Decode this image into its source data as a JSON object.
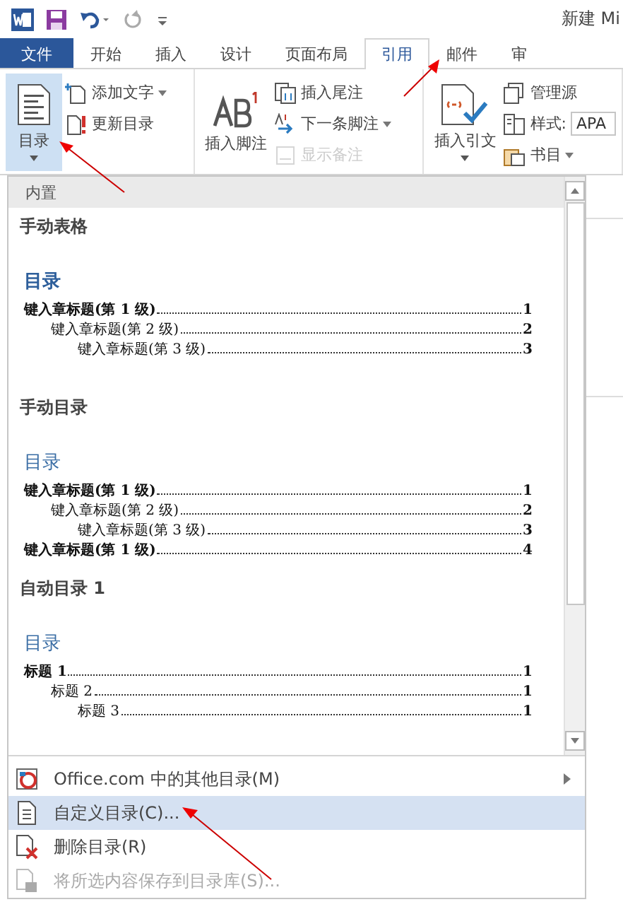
{
  "title_bar": {
    "title": "新建 Mi"
  },
  "tabs": [
    {
      "label": "文件",
      "kind": "file",
      "selected": false
    },
    {
      "label": "开始",
      "kind": "tab",
      "selected": false
    },
    {
      "label": "插入",
      "kind": "tab",
      "selected": false
    },
    {
      "label": "设计",
      "kind": "tab",
      "selected": false
    },
    {
      "label": "页面布局",
      "kind": "tab",
      "selected": false
    },
    {
      "label": "引用",
      "kind": "tab",
      "selected": true
    },
    {
      "label": "邮件",
      "kind": "tab",
      "selected": false
    },
    {
      "label": "审",
      "kind": "tab",
      "selected": false
    }
  ],
  "ribbon": {
    "groups": [
      {
        "large": {
          "label": "目录",
          "pressed": true,
          "dropdown": true
        },
        "small": [
          {
            "label": "添加文字",
            "kind": "button",
            "dropdown": true,
            "disabled": false
          },
          {
            "label": "更新目录",
            "kind": "button",
            "dropdown": false,
            "disabled": false
          }
        ]
      },
      {
        "large": {
          "label": "插入脚注",
          "pressed": false,
          "dropdown": false
        },
        "small": [
          {
            "label": "插入尾注",
            "kind": "button",
            "dropdown": false,
            "disabled": false
          },
          {
            "label": "下一条脚注",
            "kind": "button",
            "dropdown": true,
            "disabled": false
          },
          {
            "label": "显示备注",
            "kind": "button",
            "dropdown": false,
            "disabled": true
          }
        ]
      },
      {
        "large": {
          "label": "插入引文",
          "pressed": false,
          "dropdown": true
        },
        "small": [
          {
            "label": "管理源",
            "kind": "button",
            "dropdown": false,
            "disabled": false
          },
          {
            "label": "样式:",
            "kind": "field",
            "value": "APA"
          },
          {
            "label": "书目",
            "kind": "button",
            "dropdown": true,
            "disabled": false
          }
        ]
      }
    ]
  },
  "gallery": {
    "header": "内置",
    "items": [
      {
        "title": "手动表格",
        "heading": "目录",
        "entries": [
          {
            "text": "键入章标题(第 1 级)",
            "page": "1",
            "children": [
              {
                "text": "键入章标题(第 2 级)",
                "page": "2",
                "children": [
                  {
                    "text": "键入章标题(第 3 级)",
                    "page": "3"
                  }
                ]
              }
            ]
          }
        ]
      },
      {
        "title": "手动目录",
        "heading": "目录",
        "entries": [
          {
            "text": "键入章标题(第 1 级)",
            "page": "1",
            "children": [
              {
                "text": "键入章标题(第 2 级)",
                "page": "2",
                "children": [
                  {
                    "text": "键入章标题(第 3 级)",
                    "page": "3"
                  }
                ]
              }
            ]
          },
          {
            "text": "键入章标题(第 1 级)",
            "page": "4"
          }
        ]
      },
      {
        "title": "自动目录 1",
        "heading": "目录",
        "entries": [
          {
            "text": "标题 1",
            "page": "1",
            "children": [
              {
                "text": "标题 2",
                "page": "1",
                "children": [
                  {
                    "text": "标题 3",
                    "page": "1"
                  }
                ]
              }
            ]
          }
        ]
      }
    ]
  },
  "menu": [
    {
      "label": "Office.com 中的其他目录(M)",
      "submenu": true,
      "highlighted": false,
      "disabled": false
    },
    {
      "label": "自定义目录(C)...",
      "submenu": false,
      "highlighted": true,
      "disabled": false
    },
    {
      "label": "删除目录(R)",
      "submenu": false,
      "highlighted": false,
      "disabled": false
    },
    {
      "label": "将所选内容保存到目录库(S)...",
      "submenu": false,
      "highlighted": false,
      "disabled": true
    }
  ]
}
